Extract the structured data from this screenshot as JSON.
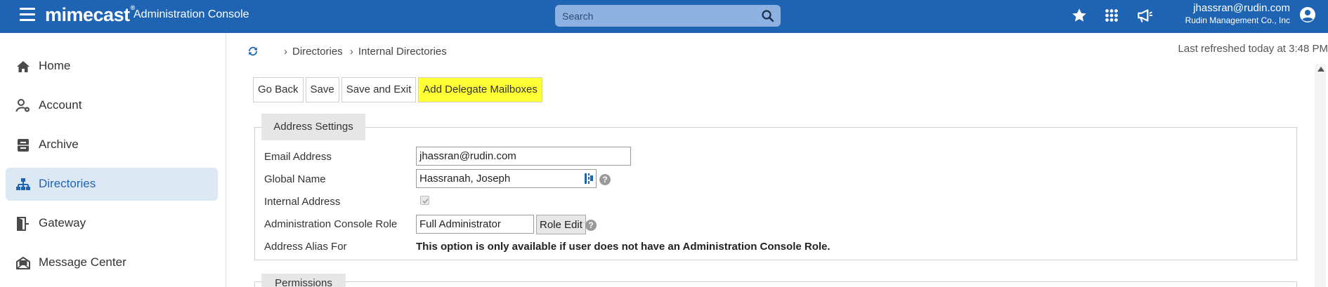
{
  "topbar": {
    "logo": "mimecast",
    "logo_tm": "®",
    "app_title": "Administration Console",
    "search_placeholder": "Search",
    "icons": [
      "menu-icon",
      "search-icon",
      "star-icon",
      "apps-grid-icon",
      "megaphone-icon",
      "user-avatar-icon"
    ],
    "user_email": "jhassran@rudin.com",
    "user_org": "Rudin Management Co., Inc"
  },
  "sidebar": {
    "items": [
      {
        "label": "Home",
        "icon": "home-icon",
        "active": false
      },
      {
        "label": "Account",
        "icon": "account-settings-icon",
        "active": false
      },
      {
        "label": "Archive",
        "icon": "archive-icon",
        "active": false
      },
      {
        "label": "Directories",
        "icon": "directories-icon",
        "active": true
      },
      {
        "label": "Gateway",
        "icon": "gateway-icon",
        "active": false
      },
      {
        "label": "Message Center",
        "icon": "message-center-icon",
        "active": false
      }
    ]
  },
  "main": {
    "breadcrumb": [
      "Directories",
      "Internal Directories"
    ],
    "last_refreshed": "Last refreshed today at 3:48 PM",
    "toolbar": {
      "go_back": "Go Back",
      "save": "Save",
      "save_and_exit": "Save and Exit",
      "add_delegate": "Add Delegate Mailboxes"
    },
    "address_settings": {
      "legend": "Address Settings",
      "email_label": "Email Address",
      "email_value": "jhassran@rudin.com",
      "global_name_label": "Global Name",
      "global_name_value": "Hassranah, Joseph",
      "internal_address_label": "Internal Address",
      "internal_address_checked": true,
      "role_label": "Administration Console Role",
      "role_value": "Full Administrator",
      "role_edit": "Role Edit",
      "alias_label": "Address Alias For",
      "alias_note": "This option is only available if user does not have an Administration Console Role."
    },
    "permissions": {
      "legend": "Permissions"
    }
  },
  "colors": {
    "brand_blue": "#1f64b3",
    "search_bg": "#8db2e1",
    "active_nav_bg": "#dde8f5",
    "highlight": "#ffff33"
  }
}
